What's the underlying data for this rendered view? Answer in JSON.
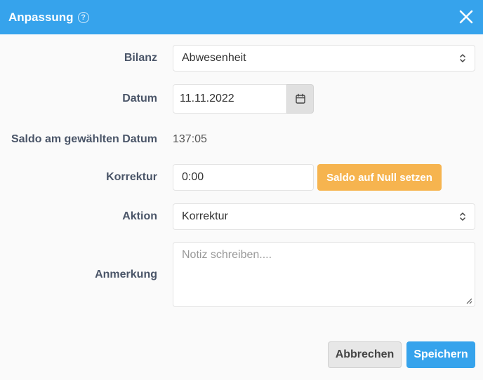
{
  "dialog": {
    "title": "Anpassung",
    "help_icon": "?"
  },
  "form": {
    "bilanz": {
      "label": "Bilanz",
      "value": "Abwesenheit"
    },
    "datum": {
      "label": "Datum",
      "value": "11.11.2022"
    },
    "saldo": {
      "label": "Saldo am gewählten Datum",
      "value": "137:05"
    },
    "korrektur": {
      "label": "Korrektur",
      "value": "0:00",
      "button_label": "Saldo auf Null setzen"
    },
    "aktion": {
      "label": "Aktion",
      "value": "Korrektur"
    },
    "anmerkung": {
      "label": "Anmerkung",
      "placeholder": "Notiz schreiben...."
    }
  },
  "footer": {
    "cancel_label": "Abbrechen",
    "save_label": "Speichern"
  },
  "colors": {
    "header": "#36a3ec",
    "accent_orange": "#f6b44f",
    "primary": "#36a3ec"
  },
  "icons": {
    "close": "close-icon",
    "help": "help-icon",
    "calendar": "calendar-icon",
    "chevron": "chevron-updown-icon"
  }
}
